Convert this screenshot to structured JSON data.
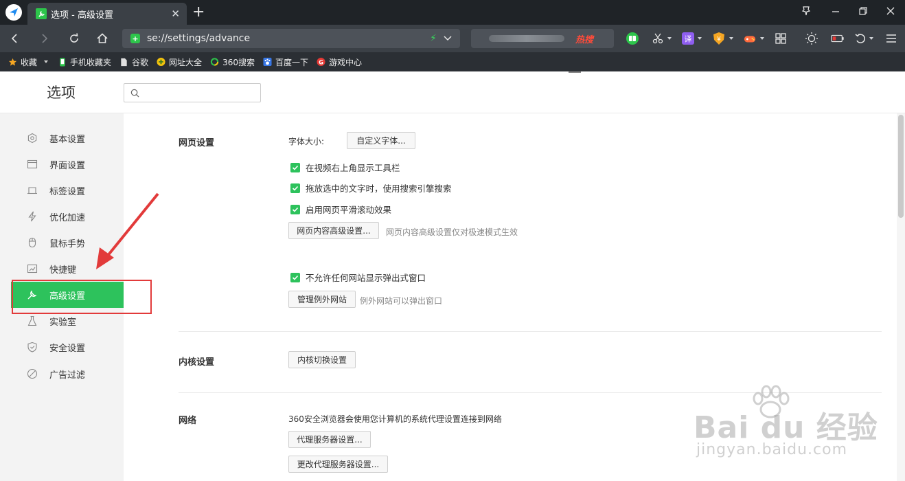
{
  "browser": {
    "tab_title": "选项 - 高级设置",
    "url": "se://settings/advance",
    "search_hot_label": "热搜",
    "window_controls": [
      "pin-icon",
      "minimize-icon",
      "restore-icon",
      "close-icon"
    ]
  },
  "bookmarks": [
    {
      "label": "收藏",
      "icon": "star-icon",
      "color": "#f5a623"
    },
    {
      "label": "手机收藏夹",
      "icon": "phone-icon",
      "color": "#2dc54b"
    },
    {
      "label": "谷歌",
      "icon": "page-icon",
      "color": "#e0e0e0"
    },
    {
      "label": "网址大全",
      "icon": "plus-circle-icon",
      "color": "#f4c20d"
    },
    {
      "label": "360搜索",
      "icon": "search-ring-icon",
      "color": "#2dc54b"
    },
    {
      "label": "百度一下",
      "icon": "paw-icon",
      "color": "#3776e4"
    },
    {
      "label": "游戏中心",
      "icon": "game-g-icon",
      "color": "#e53935"
    }
  ],
  "page": {
    "title": "选项",
    "search_placeholder": ""
  },
  "sidebar": {
    "items": [
      {
        "label": "基本设置",
        "icon": "gear-icon",
        "active": false
      },
      {
        "label": "界面设置",
        "icon": "window-icon",
        "active": false
      },
      {
        "label": "标签设置",
        "icon": "tab-icon",
        "active": false
      },
      {
        "label": "优化加速",
        "icon": "lightning-icon",
        "active": false
      },
      {
        "label": "鼠标手势",
        "icon": "mouse-icon",
        "active": false
      },
      {
        "label": "快捷键",
        "icon": "keyboard-icon",
        "active": false
      },
      {
        "label": "高级设置",
        "icon": "wrench-icon",
        "active": true
      },
      {
        "label": "实验室",
        "icon": "flask-icon",
        "active": false
      },
      {
        "label": "安全设置",
        "icon": "shield-icon",
        "active": false
      },
      {
        "label": "广告过滤",
        "icon": "block-icon",
        "active": false
      }
    ]
  },
  "sections": {
    "webpage": {
      "title": "网页设置",
      "font_size_label": "字体大小:",
      "custom_font_button": "自定义字体...",
      "checkboxes": [
        {
          "label": "在视频右上角显示工具栏",
          "checked": true
        },
        {
          "label": "拖放选中的文字时，使用搜索引擎搜索",
          "checked": true
        },
        {
          "label": "启用网页平滑滚动效果",
          "checked": true
        }
      ],
      "advanced_content_button": "网页内容高级设置...",
      "advanced_content_hint": "网页内容高级设置仅对极速模式生效",
      "popup_checkbox": {
        "label": "不允许任何网站显示弹出式窗口",
        "checked": true
      },
      "manage_exceptions_button": "管理例外网站",
      "manage_exceptions_hint": "例外网站可以弹出窗口"
    },
    "kernel": {
      "title": "内核设置",
      "switch_button": "内核切换设置"
    },
    "network": {
      "title": "网络",
      "description": "360安全浏览器会使用您计算机的系统代理设置连接到网络",
      "proxy_button": "代理服务器设置...",
      "change_proxy_button": "更改代理服务器设置..."
    }
  },
  "watermark": {
    "brand": "Bai du 经验",
    "url": "jingyan.baidu.com"
  },
  "colors": {
    "accent_green": "#2dc25c",
    "annotation_red": "#e23a3a",
    "titlebar": "#1f2327",
    "navbar": "#3b4046"
  }
}
